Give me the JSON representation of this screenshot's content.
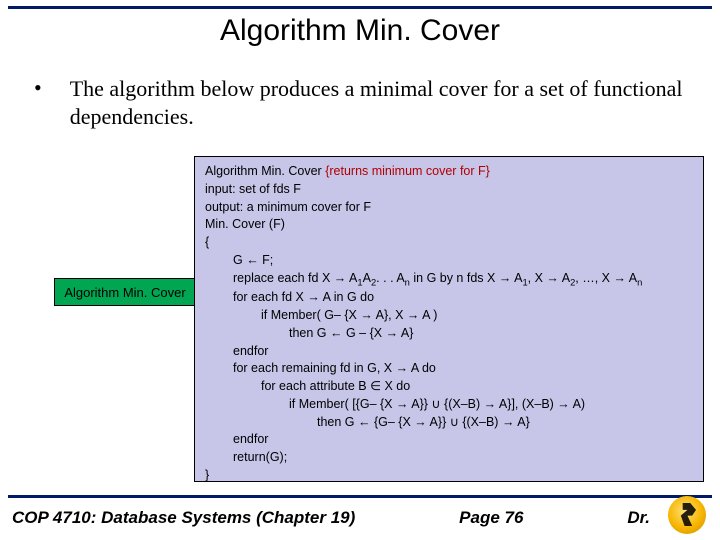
{
  "title": "Algorithm Min. Cover",
  "bullet": {
    "marker": "•",
    "text": "The algorithm below produces a minimal cover for a set of functional dependencies."
  },
  "label": "Algorithm Min. Cover",
  "algo": {
    "h1a": "Algorithm Min. Cover ",
    "h1b": " {returns minimum cover for F}",
    "h2": "input:  set of fds F",
    "h3": "output:  a minimum cover for F",
    "h4": "Min. Cover (F)",
    "h5": "{",
    "l1": "G ← F;",
    "l2a": "replace each fd X → A",
    "l2b": "A",
    "l2c": ". . . A",
    "l2d": " in G by n fds X → A",
    "l2e": ", X → A",
    "l2f": ", …, X → A",
    "l3": "for each fd X → A in G do",
    "l4": "if Member( G– {X → A}, X → A )",
    "l5": "then G ← G – {X → A}",
    "l6": "endfor",
    "l7": "for each remaining fd in G, X → A do",
    "l8": "for each attribute B ∈ X do",
    "l9": "if Member( [{G– {X → A}} ∪ {(X–B) → A}], (X–B) → A)",
    "l10": "then G ← {G– {X → A}} ∪ {(X–B) → A}",
    "l11": "endfor",
    "l12": "return(G);",
    "h6": "}",
    "sub1": "1",
    "sub2": "2",
    "subn": "n"
  },
  "footer": {
    "left": "COP 4710: Database Systems  (Chapter 19)",
    "mid": "Page 76",
    "right": "Dr."
  }
}
